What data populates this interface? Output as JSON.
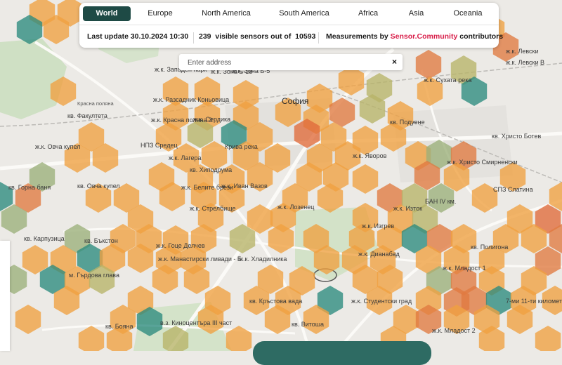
{
  "tabs": [
    "World",
    "Europe",
    "North America",
    "South America",
    "Africa",
    "Asia",
    "Oceania"
  ],
  "info": {
    "last_update": "Last update 30.10.2024 10:30",
    "visible_count": "239",
    "visible_text": "visible sensors out of",
    "total_count": "10593",
    "measurements_prefix": "Measurements by",
    "brand": "Sensor.Community",
    "measurements_suffix": "contributors"
  },
  "search": {
    "placeholder": "Enter address",
    "clear_symbol": "×"
  },
  "map_labels": [
    "София",
    "кв. Факултета",
    "ж.к. Овча купел",
    "кв. Овча купел",
    "ж.к. Западен парк",
    "ж.к. Разсадник Коньовица",
    "ж.к. Красна поляна 3",
    "НПЗ Средец",
    "ж.к. Лагера",
    "кв. Хиподрума",
    "ж.к. Белите брези",
    "ж.к. Стрелбище",
    "ж.к. Иван Вазов",
    "ж.к. Лозенец",
    "ж.к. Яворов",
    "ж.к. Изток",
    "ж.к. Изгрев",
    "ж.к. Дианабад",
    "кв. Полигона",
    "ж.к. Младост 1",
    "ж.к. Студентски град",
    "кв. Кръстова вада",
    "кв. Витоша",
    "ж.к. Христо Смирненски",
    "СПЗ Слатина",
    "БАН IV км.",
    "ж.к. Сухата река",
    "ж.к. Левски",
    "ж.к. Зона Б-5",
    "ж.к. Сердика",
    "Кривa река",
    "кв. Бъкстон",
    "ж.к. Гоце Делчев",
    "ж.к. Манастирски ливади - Б",
    "ж.к. Хладилника",
    "кв. Карпузица",
    "кв. Горна баня",
    "м. Гърдова глава",
    "кв. Бояна",
    "в.з. Киноцентъра III част",
    "ж.к. Младост 2",
    "7-ми 11-ти километър",
    "кв. Христо Ботев",
    "Красна поляна",
    "кв. Подуене",
    "ж.к. Зона Б-18",
    "ж.к. Левски В"
  ],
  "colors": {
    "orange": "#f0a040",
    "dark_orange": "#e07a40",
    "red_orange": "#e06a3a",
    "olive": "#b7b368",
    "sage": "#9bb07a",
    "teal": "#2c8a7e",
    "active_tab": "#1e4a45",
    "brand": "#d81f4a"
  }
}
